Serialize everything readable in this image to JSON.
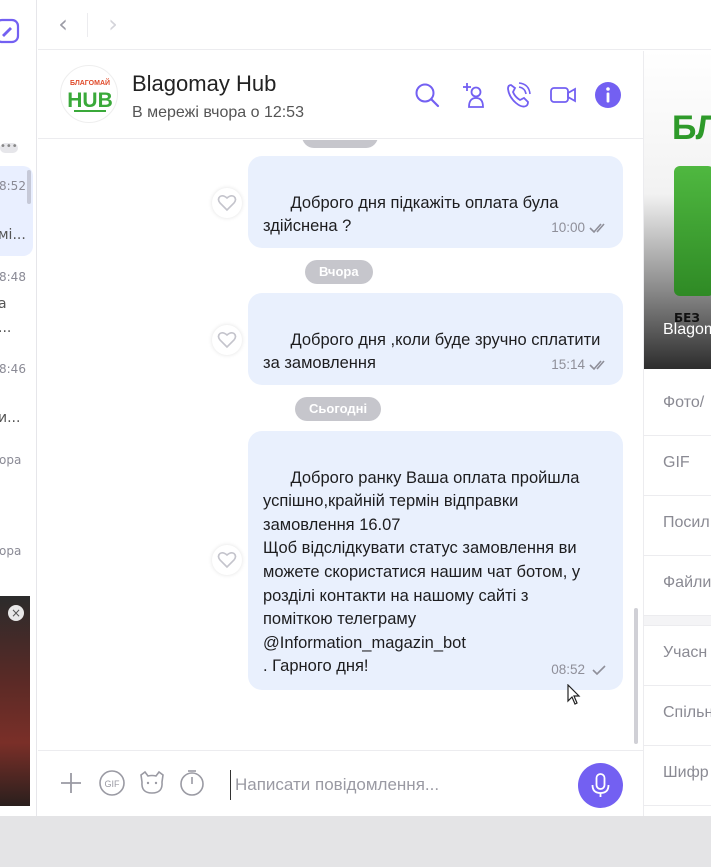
{
  "sidebar": {
    "times": [
      "8:52",
      "8:48",
      "8:46",
      "ора",
      "ора"
    ],
    "snippets": [
      "мі...",
      "а",
      "...",
      "и..."
    ],
    "more": "•••"
  },
  "nav": {
    "back": "‹",
    "forward": "›"
  },
  "header": {
    "title": "Blagomay Hub",
    "status": "В мережі вчора о 12:53",
    "avatar_text": "HUB",
    "avatar_sub": "БЛАГОМАЙ"
  },
  "messages": {
    "date_partial": "…",
    "msg1": {
      "text": "Доброго дня підкажіть оплата була\nздійснена ?",
      "time": "10:00"
    },
    "date_yesterday": "Вчора",
    "msg2": {
      "text": "Доброго дня ,коли буде зручно сплатити\nза замовлення",
      "time": "15:14"
    },
    "date_today": "Сьогодні",
    "msg3": {
      "text": "Доброго ранку Ваша оплата пройшла\nуспішно,крайній термін відправки\nзамовлення 16.07\nЩоб відслідкувати статус замовлення ви\nможете скористатися нашим чат ботом, у\nрозділі контакти на нашому сайті з\nпоміткою телеграму\n@Information_magazin_bot\n. Гарного дня!",
      "time": "08:52"
    }
  },
  "composer": {
    "placeholder": "Написати повідомлення..."
  },
  "rightpanel": {
    "banner_text": "БЛ",
    "banner_small": "БЕЗ",
    "banner_caption": "Blagom",
    "sections": [
      "Фото/",
      "GIF",
      "Посил",
      "Файли",
      "Учасн",
      "Спільн",
      "Шифр"
    ]
  },
  "colors": {
    "accent": "#7360f2",
    "bubble": "#e9f0fd"
  }
}
